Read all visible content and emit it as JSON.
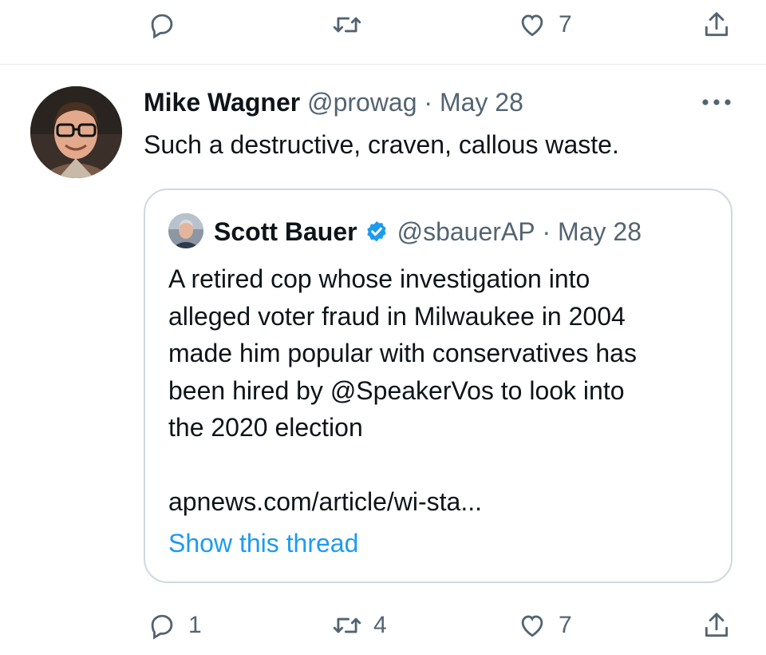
{
  "top_actions": {
    "reply_count": "",
    "retweet_count": "",
    "like_count": "7"
  },
  "tweet": {
    "name": "Mike Wagner",
    "handle": "@prowag",
    "separator": "·",
    "date": "May 28",
    "text": "Such a destructive, craven, callous waste."
  },
  "quoted_tweet": {
    "name": "Scott Bauer",
    "handle": "@sbauerAP",
    "separator": "·",
    "date": "May 28",
    "text": "A retired cop whose investigation into\nalleged voter fraud in Milwaukee in 2004\nmade him popular with conservatives has\nbeen hired by @SpeakerVos to look into\nthe 2020 election",
    "link": "apnews.com/article/wi-sta...",
    "show_thread": "Show this thread"
  },
  "bottom_actions": {
    "reply_count": "1",
    "retweet_count": "4",
    "like_count": "7"
  },
  "colors": {
    "accent": "#1d9bf0",
    "secondary_text": "#536471",
    "border": "#cfd9de"
  },
  "icons": [
    "reply-icon",
    "retweet-icon",
    "like-icon",
    "share-icon",
    "more-icon",
    "verified-badge-icon"
  ]
}
